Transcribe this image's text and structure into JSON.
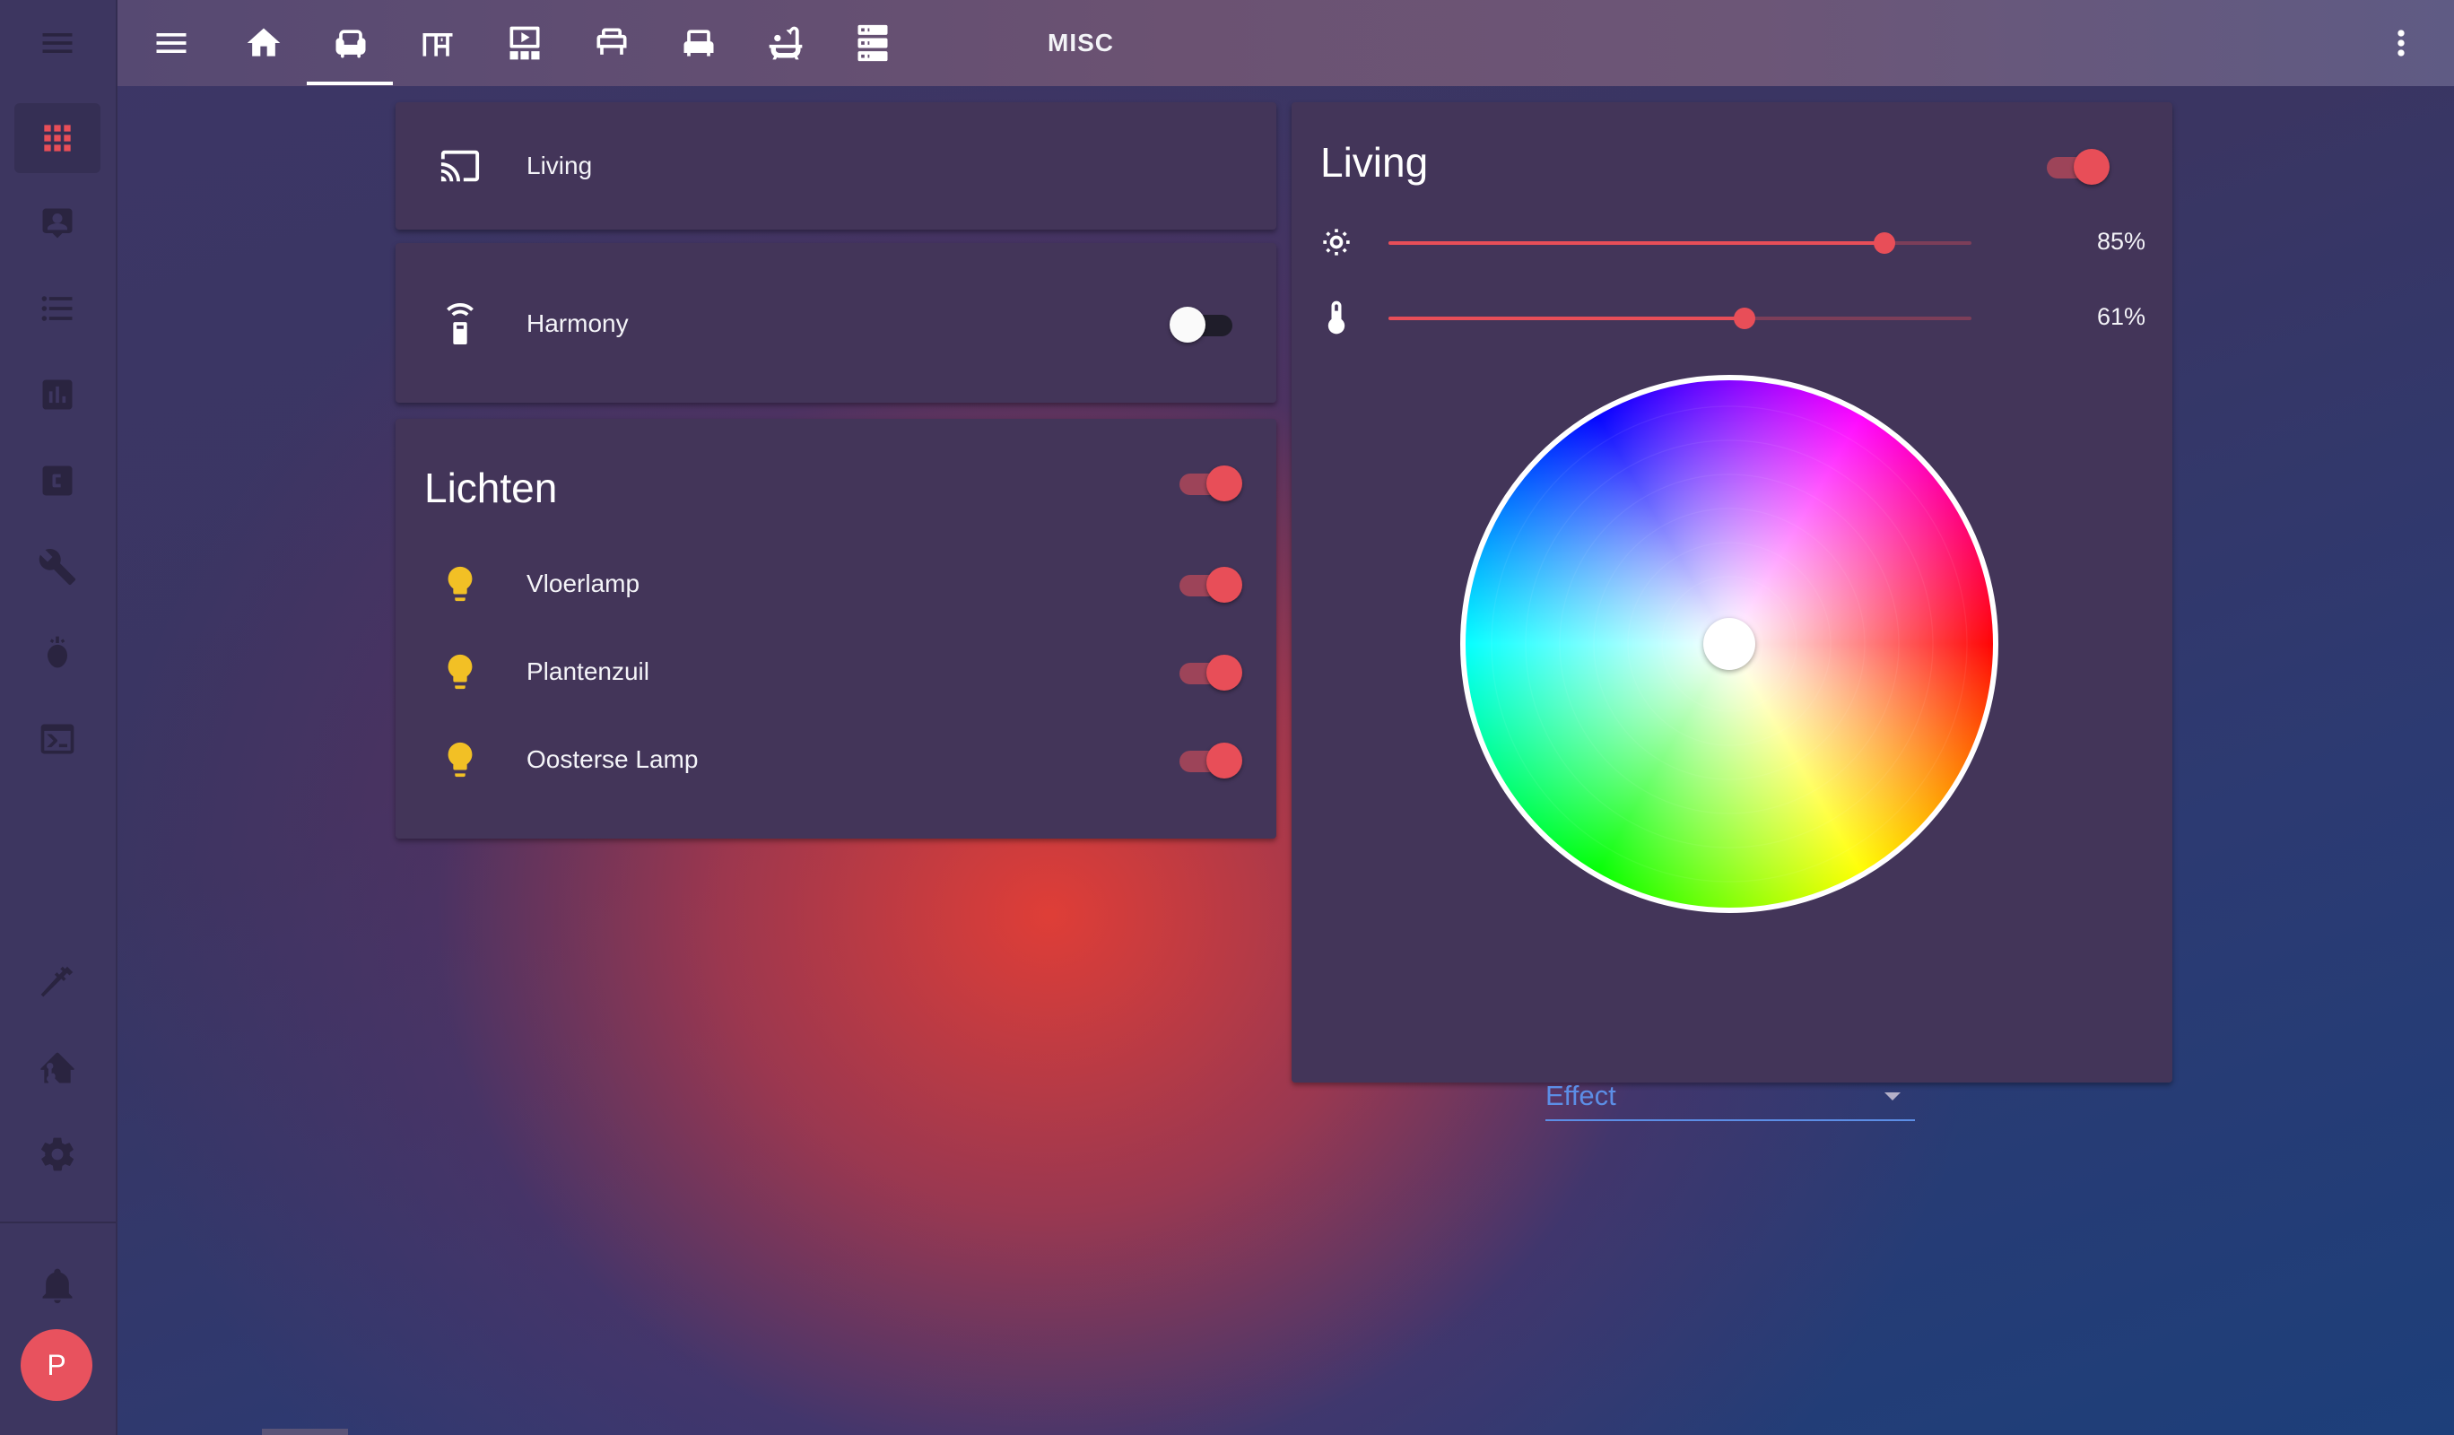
{
  "topbar": {
    "tabs": [
      {
        "icon": "home-icon"
      },
      {
        "icon": "sofa-icon",
        "active": true
      },
      {
        "icon": "desk-icon"
      },
      {
        "icon": "media-room-icon"
      },
      {
        "icon": "bed-icon"
      },
      {
        "icon": "seat-icon"
      },
      {
        "icon": "bathtub-icon"
      },
      {
        "icon": "server-icon"
      }
    ],
    "misc_label": "MISC",
    "menu_icon": "menu-icon",
    "overflow_icon": "dots-vertical-icon"
  },
  "sidebar": {
    "items": [
      {
        "icon": "apps-grid-icon",
        "active": true
      },
      {
        "icon": "account-box-icon"
      },
      {
        "icon": "list-icon"
      },
      {
        "icon": "chart-bar-icon"
      },
      {
        "icon": "hacs-icon"
      },
      {
        "icon": "wrench-icon"
      },
      {
        "icon": "node-red-icon"
      },
      {
        "icon": "terminal-icon"
      }
    ],
    "bottom_items": [
      {
        "icon": "hammer-icon"
      },
      {
        "icon": "home-assistant-icon"
      },
      {
        "icon": "gear-icon"
      }
    ],
    "notifications_icon": "bell-icon",
    "avatar_initial": "P"
  },
  "cards": {
    "living_media": {
      "label": "Living",
      "icon": "cast-icon"
    },
    "harmony": {
      "label": "Harmony",
      "icon": "remote-icon",
      "state": "off"
    },
    "lichten": {
      "title": "Lichten",
      "group_state": "on",
      "items": [
        {
          "label": "Vloerlamp",
          "icon": "lightbulb-icon",
          "state": "on"
        },
        {
          "label": "Plantenzuil",
          "icon": "lightbulb-icon",
          "state": "on"
        },
        {
          "label": "Oosterse Lamp",
          "icon": "lightbulb-icon",
          "state": "on"
        }
      ]
    },
    "living_light": {
      "title": "Living",
      "state": "on",
      "brightness": {
        "value": 0.85,
        "label": "85%",
        "icon": "brightness-icon"
      },
      "color_temp": {
        "value": 0.61,
        "label": "61%",
        "icon": "thermometer-icon"
      },
      "effect_label": "Effect"
    }
  },
  "colors": {
    "accent": "#e84e58",
    "card_bg": "#433559",
    "sidebar_bg": "#3d3660",
    "bulb_on": "#f2c025",
    "effect_blue": "#5c8ee6"
  }
}
